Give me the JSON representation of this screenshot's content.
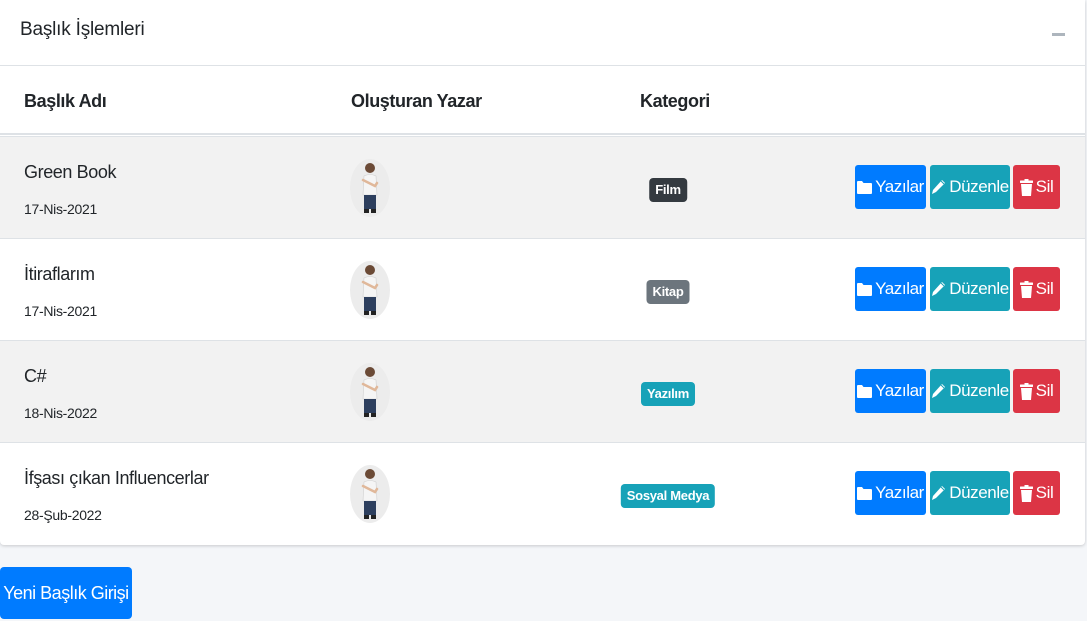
{
  "card": {
    "title": "Başlık İşlemleri"
  },
  "table": {
    "headers": {
      "title": "Başlık Adı",
      "author": "Oluşturan Yazar",
      "category": "Kategori"
    },
    "rows": [
      {
        "title": "Green Book",
        "date": "17-Nis-2021",
        "category": "Film",
        "category_color": "#343a40"
      },
      {
        "title": "İtiraflarım",
        "date": "17-Nis-2021",
        "category": "Kitap",
        "category_color": "#6c757d"
      },
      {
        "title": "C#",
        "date": "18-Nis-2022",
        "category": "Yazılım",
        "category_color": "#17a2b8"
      },
      {
        "title": "İfşası çıkan Influencerlar",
        "date": "28-Şub-2022",
        "category": "Sosyal Medya",
        "category_color": "#17a2b8"
      }
    ]
  },
  "actions": {
    "posts_label": "Yazılar",
    "edit_label": "Düzenle",
    "delete_label": "Sil"
  },
  "new_button_label": "Yeni Başlık Girişi",
  "colors": {
    "primary": "#007bff",
    "info": "#17a2b8",
    "danger": "#dc3545",
    "dark": "#343a40",
    "secondary": "#6c757d"
  },
  "icons": {
    "posts": "folder-icon",
    "edit": "pencil-icon",
    "delete": "trash-icon",
    "collapse": "minus-icon"
  }
}
